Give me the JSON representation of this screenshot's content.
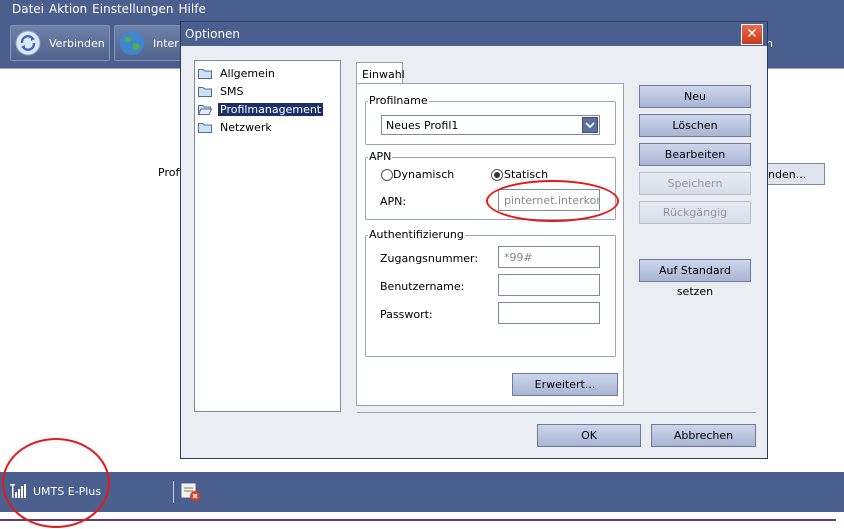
{
  "app": {
    "menu": [
      "Datei",
      "Aktion",
      "Einstellungen",
      "Hilfe"
    ],
    "toolbar": {
      "connect_label": "Verbinden",
      "internet_label_fragment": "Inter",
      "title_fragment": "n"
    },
    "background": {
      "profile_label_fragment": "Profil",
      "connect_button_fragment": "nden..."
    },
    "status": {
      "network": "UMTS E-Plus"
    },
    "colors": {
      "chrome": "#4a5f8e",
      "annotation": "#e21a1a"
    }
  },
  "dialog": {
    "title": "Optionen",
    "tree": [
      {
        "label": "Allgemein",
        "icon": "folder-icon",
        "selected": false
      },
      {
        "label": "SMS",
        "icon": "folder-icon",
        "selected": false
      },
      {
        "label": "Profilmanagement",
        "icon": "folder-open-icon",
        "selected": true
      },
      {
        "label": "Netzwerk",
        "icon": "folder-icon",
        "selected": false
      }
    ],
    "tab": "Einwahl",
    "profile": {
      "group_title": "Profilname",
      "selected": "Neues Profil1"
    },
    "apn": {
      "group_title": "APN",
      "dynamic_label": "Dynamisch",
      "static_label": "Statisch",
      "selected_mode": "Statisch",
      "apn_label": "APN:",
      "apn_value": "pinternet.interkom."
    },
    "auth": {
      "group_title": "Authentifizierung",
      "dialnumber_label": "Zugangsnummer:",
      "dialnumber_value": "*99#",
      "username_label": "Benutzername:",
      "username_value": "",
      "password_label": "Passwort:",
      "password_value": ""
    },
    "buttons": {
      "new": "Neu",
      "delete": "Löschen",
      "edit": "Bearbeiten",
      "save": "Speichern",
      "undo": "Rückgängig",
      "reset": "Auf Standard setzen",
      "advanced": "Erweitert...",
      "ok": "OK",
      "cancel": "Abbrechen"
    }
  }
}
